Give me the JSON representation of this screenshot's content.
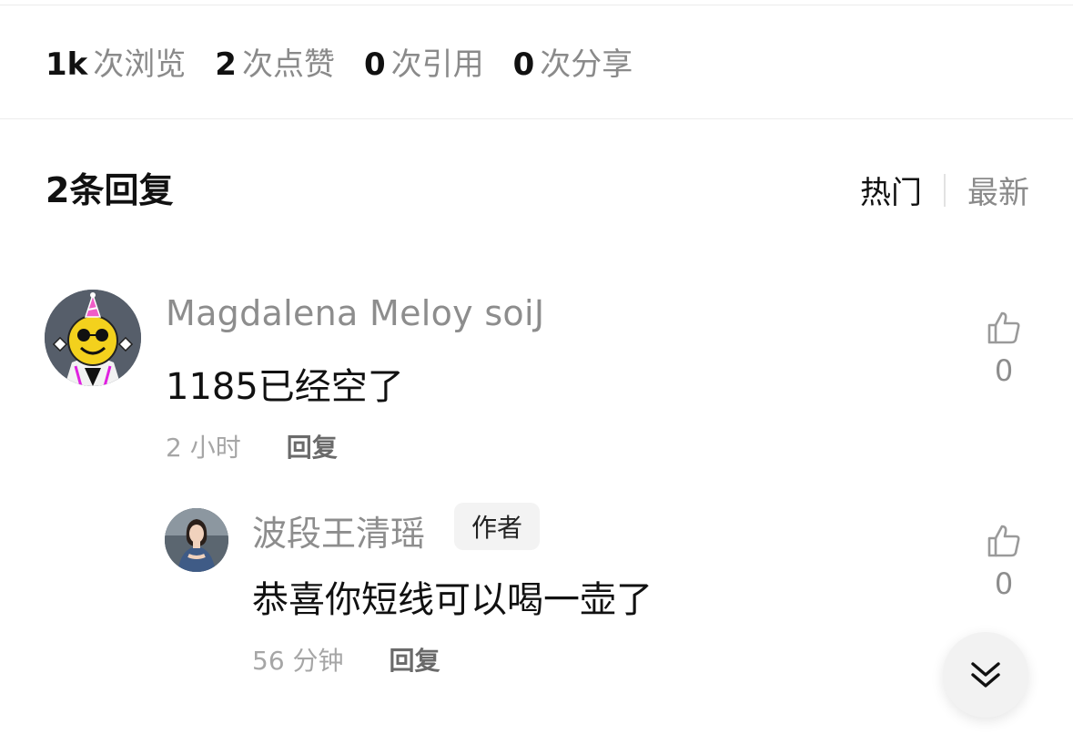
{
  "stats": [
    {
      "num": "1k",
      "label": "次浏览"
    },
    {
      "num": "2",
      "label": "次点赞"
    },
    {
      "num": "0",
      "label": "次引用"
    },
    {
      "num": "0",
      "label": "次分享"
    }
  ],
  "replies": {
    "title": "2条回复",
    "sort": {
      "hot": "热门",
      "new": "最新"
    }
  },
  "comments": [
    {
      "username": "Magdalena Meloy soiJ",
      "text": "1185已经空了",
      "time": "2 小时",
      "reply_label": "回复",
      "likes": "0",
      "avatar_icon": "party-hat-smiley-avatar"
    },
    {
      "username": "波段王清瑶",
      "badge": "作者",
      "text": "恭喜你短线可以喝一壶了",
      "time": "56 分钟",
      "reply_label": "回复",
      "likes": "0",
      "avatar_icon": "woman-portrait-avatar"
    }
  ],
  "icons": {
    "like": "thumbs-up-icon",
    "scroll": "double-chevron-down-icon"
  },
  "colors": {
    "muted": "#8d8d8d",
    "text": "#111111",
    "badge_bg": "#f3f3f3"
  }
}
